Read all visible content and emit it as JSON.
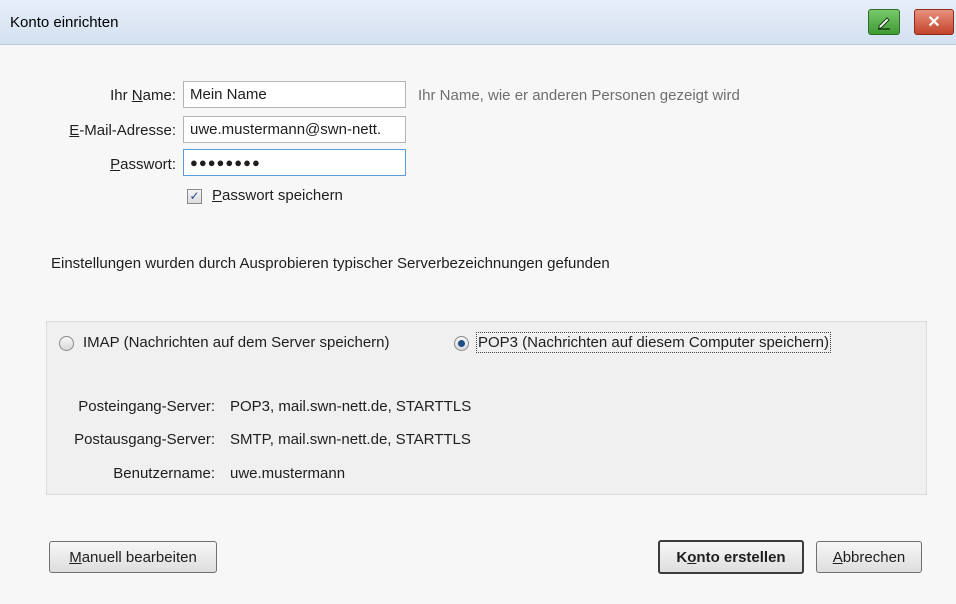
{
  "window": {
    "title": "Konto einrichten",
    "close_glyph": "✕",
    "edit_glyph": "✎"
  },
  "form": {
    "name_label_pre": "Ihr ",
    "name_label_key": "N",
    "name_label_post": "ame:",
    "name_value": "Mein Name",
    "name_hint": "Ihr Name, wie er anderen Personen gezeigt wird",
    "email_label_key": "E",
    "email_label_post": "-Mail-Adresse:",
    "email_value": "uwe.mustermann@swn-nett.",
    "password_label_key": "P",
    "password_label_post": "asswort:",
    "password_value": "●●●●●●●●",
    "remember_checked": true,
    "remember_key": "P",
    "remember_post": "asswort speichern"
  },
  "info_text": "Einstellungen wurden durch Ausprobieren typischer Serverbezeichnungen gefunden",
  "server": {
    "imap_label": "IMAP (Nachrichten auf dem Server speichern)",
    "pop3_label": "POP3 (Nachrichten auf diesem Computer speichern)",
    "selected": "pop3",
    "incoming_label": "Posteingang-Server:",
    "incoming_value": "POP3, mail.swn-nett.de, STARTTLS",
    "outgoing_label": "Postausgang-Server:",
    "outgoing_value": "SMTP, mail.swn-nett.de, STARTTLS",
    "username_label": "Benutzername:",
    "username_value": "uwe.mustermann"
  },
  "buttons": {
    "manual_key": "M",
    "manual_post": "anuell bearbeiten",
    "create_pre": "K",
    "create_key": "o",
    "create_post": "nto erstellen",
    "cancel_key": "A",
    "cancel_post": "bbrechen"
  },
  "colors": {
    "accent": "#1d4c86",
    "titlebar": "#d4e1f1"
  }
}
